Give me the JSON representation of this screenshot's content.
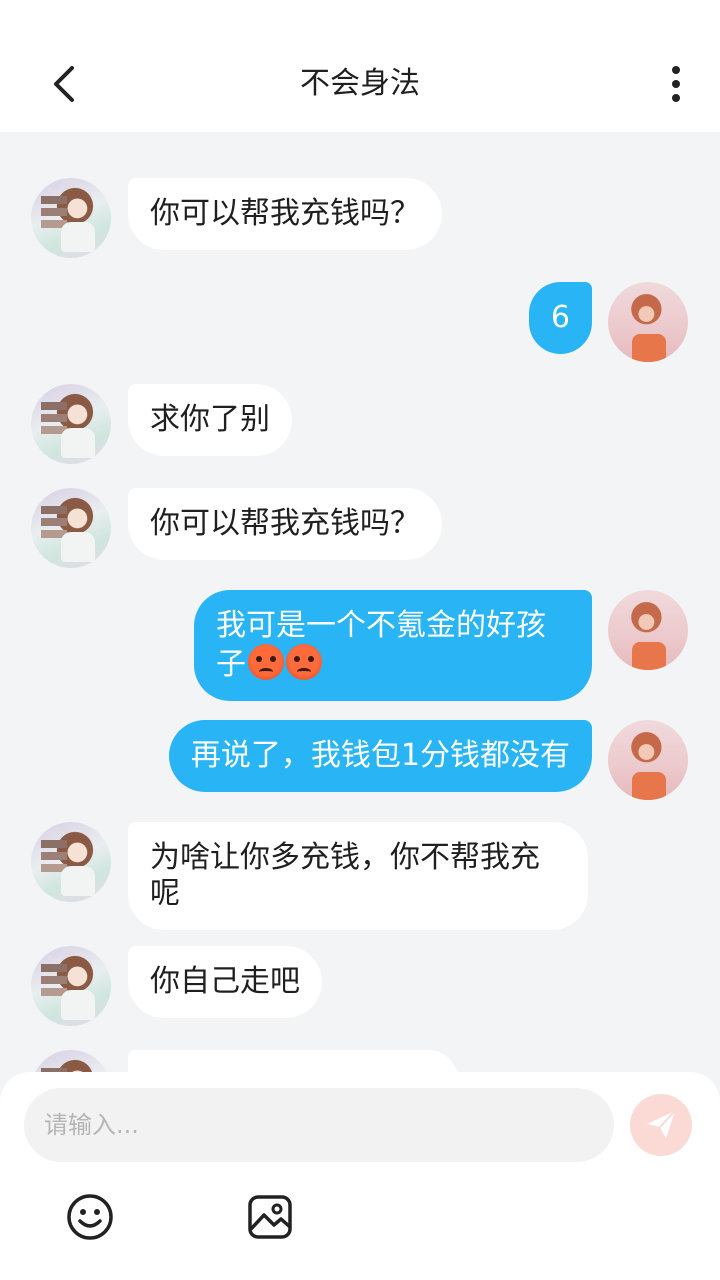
{
  "header": {
    "title": "不会身法"
  },
  "messages": [
    {
      "side": "bot",
      "text": "你可以帮我充钱吗？"
    },
    {
      "side": "me",
      "text": "6"
    },
    {
      "side": "bot",
      "text": "求你了别"
    },
    {
      "side": "bot",
      "text": "你可以帮我充钱吗？"
    },
    {
      "side": "me",
      "text": "我可是一个不氪金的好孩子",
      "emojis": [
        "angry-face",
        "angry-face"
      ]
    },
    {
      "side": "me",
      "text": "再说了，我钱包1分钱都没有"
    },
    {
      "side": "bot",
      "text": "为啥让你多充钱，你不帮我充呢"
    },
    {
      "side": "bot",
      "text": "你自己走吧"
    }
  ],
  "composer": {
    "placeholder": "请输入..."
  },
  "icons": {
    "back": "chevron-left-icon",
    "more": "vertical-dots-icon",
    "send": "paper-plane-icon",
    "emoji": "smiley-icon",
    "image": "image-icon"
  },
  "colors": {
    "my_bubble": "#29b4f5",
    "bot_bubble": "#ffffff",
    "background": "#f3f4f6",
    "send_button": "#fbd9d4"
  }
}
